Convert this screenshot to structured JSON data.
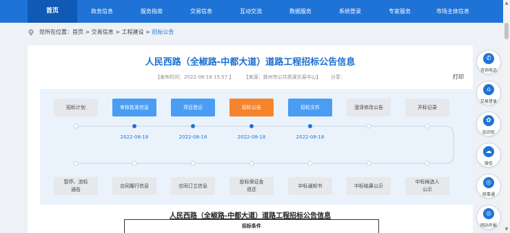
{
  "nav": {
    "items": [
      "首页",
      "政务信息",
      "服务指南",
      "交易信息",
      "互动交流",
      "数据服务",
      "系统登录",
      "专家服务",
      "市场主体信息"
    ],
    "active_index": 0
  },
  "breadcrumb": {
    "prefix": "您所在位置：首页 > 交易信息 > 工程建设 > ",
    "current": "招标公告"
  },
  "notice": {
    "title": "人民西路（全椒路-中都大道）道路工程招标公告信息",
    "publish_time": "【发布时间：2022-08-18 15:57 】",
    "source": "【来源：滁州市公共资源交易中心】",
    "share": "分享：",
    "print": "打印"
  },
  "flow": {
    "top_steps": [
      "招标计划",
      "审核批准信息",
      "项目登记",
      "招标公告",
      "招标文件",
      "澄清修改公告",
      "开标记录"
    ],
    "top_states": [
      "gray",
      "blue",
      "blue",
      "orange",
      "blue",
      "gray",
      "gray"
    ],
    "dates": [
      "2022-08-18",
      "2022-08-18",
      "2022-08-18",
      "2022-08-18"
    ],
    "bottom_steps": [
      "暂停、流标\n通告",
      "合同履行信息",
      "合同订立信息",
      "投标保证金\n退还",
      "中标通知书",
      "中标结果公示",
      "中标候选人\n公示"
    ]
  },
  "document": {
    "title": "人民西路（全椒路-中都大道）道路工程招标公告信息",
    "table_header": "招标条件"
  },
  "side": {
    "items": [
      {
        "label": "咨询电话",
        "icon": "phone-icon",
        "glyph": "✆"
      },
      {
        "label": "交易登录",
        "icon": "login-icon",
        "glyph": "⌂"
      },
      {
        "label": "知识库",
        "icon": "knowledge-icon",
        "glyph": "✿"
      },
      {
        "label": "微信",
        "icon": "wechat-icon",
        "glyph": "☁"
      },
      {
        "label": "皖事通",
        "icon": "wanshitong-icon",
        "glyph": "◎"
      },
      {
        "label": "网站年报",
        "icon": "annual-report-icon",
        "glyph": "◎"
      }
    ]
  },
  "colors": {
    "nav_bg": "#1f73d6",
    "nav_active": "#1059b5",
    "step_blue": "#4a9df2",
    "step_orange": "#f5832c",
    "step_gray": "#e6e8eb",
    "title_blue": "#1a6fd0"
  }
}
